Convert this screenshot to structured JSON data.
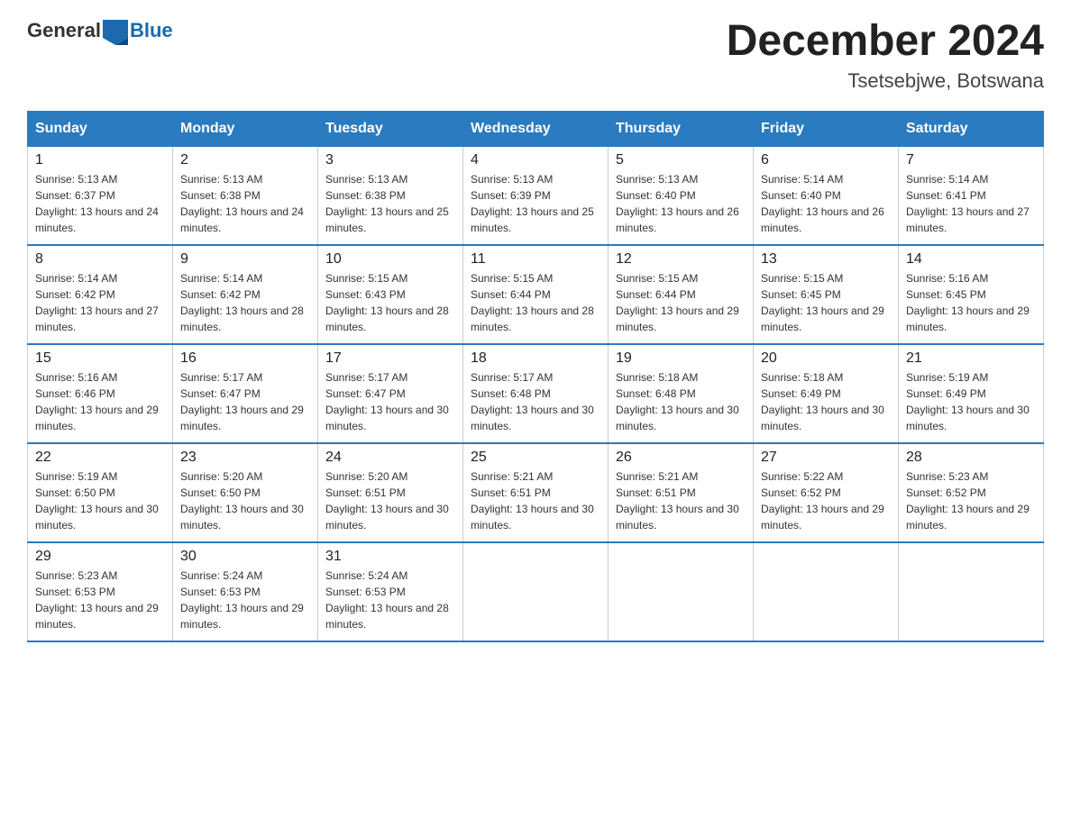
{
  "logo": {
    "text_general": "General",
    "text_blue": "Blue"
  },
  "title": "December 2024",
  "subtitle": "Tsetsebjwe, Botswana",
  "days_of_week": [
    "Sunday",
    "Monday",
    "Tuesday",
    "Wednesday",
    "Thursday",
    "Friday",
    "Saturday"
  ],
  "weeks": [
    [
      {
        "day": "1",
        "sunrise": "5:13 AM",
        "sunset": "6:37 PM",
        "daylight": "13 hours and 24 minutes."
      },
      {
        "day": "2",
        "sunrise": "5:13 AM",
        "sunset": "6:38 PM",
        "daylight": "13 hours and 24 minutes."
      },
      {
        "day": "3",
        "sunrise": "5:13 AM",
        "sunset": "6:38 PM",
        "daylight": "13 hours and 25 minutes."
      },
      {
        "day": "4",
        "sunrise": "5:13 AM",
        "sunset": "6:39 PM",
        "daylight": "13 hours and 25 minutes."
      },
      {
        "day": "5",
        "sunrise": "5:13 AM",
        "sunset": "6:40 PM",
        "daylight": "13 hours and 26 minutes."
      },
      {
        "day": "6",
        "sunrise": "5:14 AM",
        "sunset": "6:40 PM",
        "daylight": "13 hours and 26 minutes."
      },
      {
        "day": "7",
        "sunrise": "5:14 AM",
        "sunset": "6:41 PM",
        "daylight": "13 hours and 27 minutes."
      }
    ],
    [
      {
        "day": "8",
        "sunrise": "5:14 AM",
        "sunset": "6:42 PM",
        "daylight": "13 hours and 27 minutes."
      },
      {
        "day": "9",
        "sunrise": "5:14 AM",
        "sunset": "6:42 PM",
        "daylight": "13 hours and 28 minutes."
      },
      {
        "day": "10",
        "sunrise": "5:15 AM",
        "sunset": "6:43 PM",
        "daylight": "13 hours and 28 minutes."
      },
      {
        "day": "11",
        "sunrise": "5:15 AM",
        "sunset": "6:44 PM",
        "daylight": "13 hours and 28 minutes."
      },
      {
        "day": "12",
        "sunrise": "5:15 AM",
        "sunset": "6:44 PM",
        "daylight": "13 hours and 29 minutes."
      },
      {
        "day": "13",
        "sunrise": "5:15 AM",
        "sunset": "6:45 PM",
        "daylight": "13 hours and 29 minutes."
      },
      {
        "day": "14",
        "sunrise": "5:16 AM",
        "sunset": "6:45 PM",
        "daylight": "13 hours and 29 minutes."
      }
    ],
    [
      {
        "day": "15",
        "sunrise": "5:16 AM",
        "sunset": "6:46 PM",
        "daylight": "13 hours and 29 minutes."
      },
      {
        "day": "16",
        "sunrise": "5:17 AM",
        "sunset": "6:47 PM",
        "daylight": "13 hours and 29 minutes."
      },
      {
        "day": "17",
        "sunrise": "5:17 AM",
        "sunset": "6:47 PM",
        "daylight": "13 hours and 30 minutes."
      },
      {
        "day": "18",
        "sunrise": "5:17 AM",
        "sunset": "6:48 PM",
        "daylight": "13 hours and 30 minutes."
      },
      {
        "day": "19",
        "sunrise": "5:18 AM",
        "sunset": "6:48 PM",
        "daylight": "13 hours and 30 minutes."
      },
      {
        "day": "20",
        "sunrise": "5:18 AM",
        "sunset": "6:49 PM",
        "daylight": "13 hours and 30 minutes."
      },
      {
        "day": "21",
        "sunrise": "5:19 AM",
        "sunset": "6:49 PM",
        "daylight": "13 hours and 30 minutes."
      }
    ],
    [
      {
        "day": "22",
        "sunrise": "5:19 AM",
        "sunset": "6:50 PM",
        "daylight": "13 hours and 30 minutes."
      },
      {
        "day": "23",
        "sunrise": "5:20 AM",
        "sunset": "6:50 PM",
        "daylight": "13 hours and 30 minutes."
      },
      {
        "day": "24",
        "sunrise": "5:20 AM",
        "sunset": "6:51 PM",
        "daylight": "13 hours and 30 minutes."
      },
      {
        "day": "25",
        "sunrise": "5:21 AM",
        "sunset": "6:51 PM",
        "daylight": "13 hours and 30 minutes."
      },
      {
        "day": "26",
        "sunrise": "5:21 AM",
        "sunset": "6:51 PM",
        "daylight": "13 hours and 30 minutes."
      },
      {
        "day": "27",
        "sunrise": "5:22 AM",
        "sunset": "6:52 PM",
        "daylight": "13 hours and 29 minutes."
      },
      {
        "day": "28",
        "sunrise": "5:23 AM",
        "sunset": "6:52 PM",
        "daylight": "13 hours and 29 minutes."
      }
    ],
    [
      {
        "day": "29",
        "sunrise": "5:23 AM",
        "sunset": "6:53 PM",
        "daylight": "13 hours and 29 minutes."
      },
      {
        "day": "30",
        "sunrise": "5:24 AM",
        "sunset": "6:53 PM",
        "daylight": "13 hours and 29 minutes."
      },
      {
        "day": "31",
        "sunrise": "5:24 AM",
        "sunset": "6:53 PM",
        "daylight": "13 hours and 28 minutes."
      },
      null,
      null,
      null,
      null
    ]
  ]
}
